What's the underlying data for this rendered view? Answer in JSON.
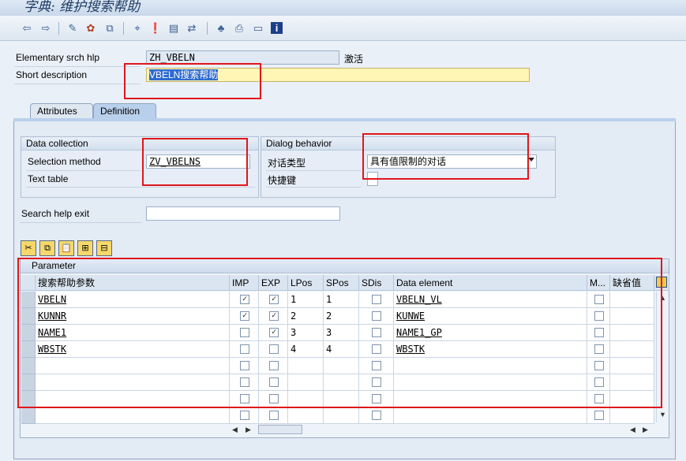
{
  "window": {
    "title": "字典: 维护搜索帮助"
  },
  "toolbar": {
    "icons": [
      "back-icon",
      "forward-icon",
      "edit-icon",
      "activate-icon",
      "copy-object-icon",
      "where-used-icon",
      "display-icon",
      "object-list-icon",
      "navigate-icon",
      "hierarchy-icon",
      "print-icon",
      "layout-icon",
      "info-icon"
    ]
  },
  "header": {
    "name_label": "Elementary srch hlp",
    "name_value": "ZH_VBELN",
    "status": "激活",
    "short_desc_label": "Short description",
    "short_desc_value": "VBELN搜索帮助"
  },
  "tabs": [
    {
      "label": "Attributes",
      "active": false
    },
    {
      "label": "Definition",
      "active": true
    }
  ],
  "data_collection": {
    "title": "Data collection",
    "selection_method_label": "Selection method",
    "selection_method_value": "ZV_VBELNS",
    "text_table_label": "Text table",
    "text_table_value": ""
  },
  "dialog_behavior": {
    "title": "Dialog behavior",
    "dialog_type_label": "对话类型",
    "dialog_type_value": "具有值限制的对话",
    "hotkey_label": "快捷键",
    "hotkey_value": ""
  },
  "search_help_exit": {
    "label": "Search help exit",
    "value": ""
  },
  "table": {
    "title": "Parameter",
    "columns": [
      "搜索帮助参数",
      "IMP",
      "EXP",
      "LPos",
      "SPos",
      "SDis",
      "Data element",
      "M...",
      "缺省值"
    ],
    "rows": [
      {
        "param": "VBELN",
        "imp": true,
        "exp": true,
        "lpos": "1",
        "spos": "1",
        "sdis": false,
        "data_element": "VBELN_VL",
        "m": false,
        "default": ""
      },
      {
        "param": "KUNNR",
        "imp": true,
        "exp": true,
        "lpos": "2",
        "spos": "2",
        "sdis": false,
        "data_element": "KUNWE",
        "m": false,
        "default": ""
      },
      {
        "param": "NAME1",
        "imp": false,
        "exp": true,
        "lpos": "3",
        "spos": "3",
        "sdis": false,
        "data_element": "NAME1_GP",
        "m": false,
        "default": ""
      },
      {
        "param": "WBSTK",
        "imp": false,
        "exp": false,
        "lpos": "4",
        "spos": "4",
        "sdis": false,
        "data_element": "WBSTK",
        "m": false,
        "default": ""
      },
      {
        "param": "",
        "imp": false,
        "exp": false,
        "lpos": "",
        "spos": "",
        "sdis": false,
        "data_element": "",
        "m": false,
        "default": ""
      },
      {
        "param": "",
        "imp": false,
        "exp": false,
        "lpos": "",
        "spos": "",
        "sdis": false,
        "data_element": "",
        "m": false,
        "default": ""
      },
      {
        "param": "",
        "imp": false,
        "exp": false,
        "lpos": "",
        "spos": "",
        "sdis": false,
        "data_element": "",
        "m": false,
        "default": ""
      },
      {
        "param": "",
        "imp": false,
        "exp": false,
        "lpos": "",
        "spos": "",
        "sdis": false,
        "data_element": "",
        "m": false,
        "default": ""
      }
    ]
  },
  "colors": {
    "highlight_box": "#e0161b",
    "input_yellow": "#fff5b5",
    "selection": "#2f6bd0"
  }
}
